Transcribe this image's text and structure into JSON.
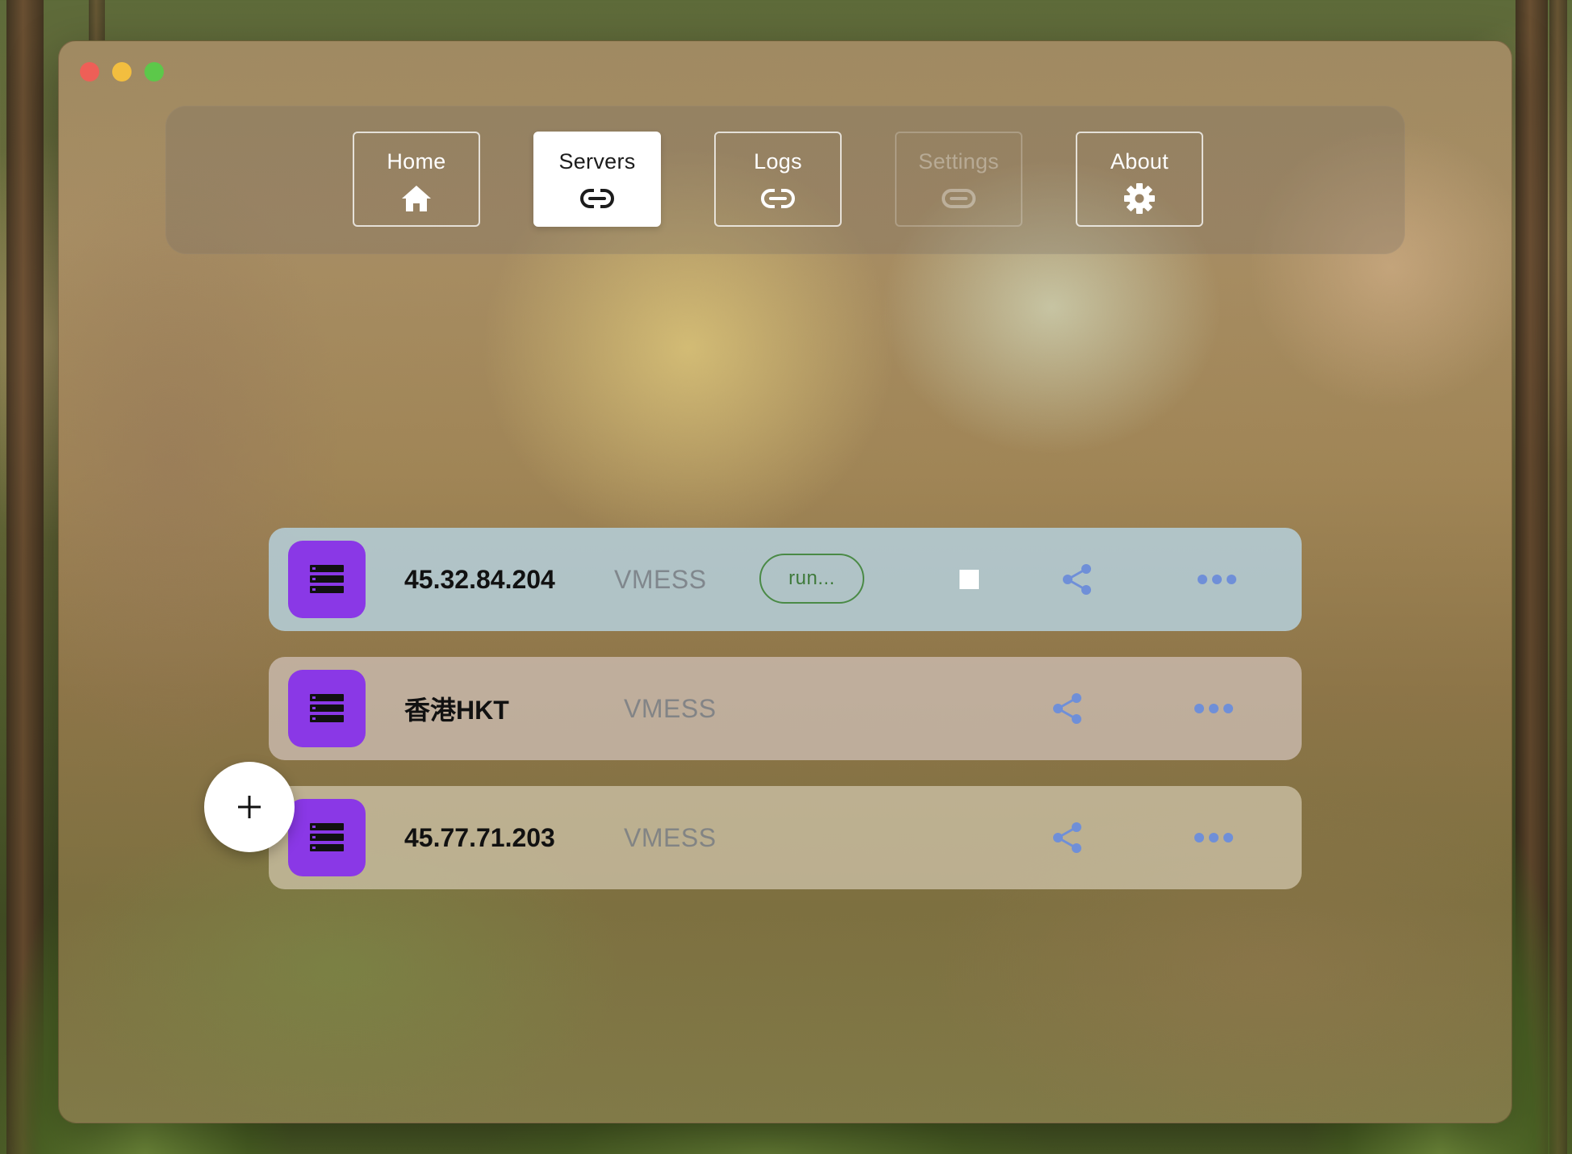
{
  "window": {
    "controls": [
      "close",
      "minimize",
      "maximize"
    ]
  },
  "nav": {
    "items": [
      {
        "label": "Home",
        "icon": "home-icon",
        "state": "normal"
      },
      {
        "label": "Servers",
        "icon": "link-icon",
        "state": "active"
      },
      {
        "label": "Logs",
        "icon": "link-icon",
        "state": "normal"
      },
      {
        "label": "Settings",
        "icon": "link-icon",
        "state": "disabled"
      },
      {
        "label": "About",
        "icon": "gear-icon",
        "state": "normal"
      }
    ]
  },
  "servers": [
    {
      "name": "45.32.84.204",
      "protocol": "VMESS",
      "status": "run...",
      "running": true,
      "icon": "server-icon"
    },
    {
      "name": "香港HKT",
      "protocol": "VMESS",
      "running": false,
      "icon": "server-icon"
    },
    {
      "name": "45.77.71.203",
      "protocol": "VMESS",
      "running": false,
      "icon": "server-icon"
    }
  ],
  "fab": {
    "symbol": "+",
    "icon": "plus-icon"
  },
  "colors": {
    "accent_purple": "#8a38e6",
    "share_blue": "#6f8fd8",
    "running_green": "#3f7a3b",
    "close_red": "#ee5f57",
    "minimize_yellow": "#f3be3f",
    "maximize_green": "#5cc84a"
  }
}
